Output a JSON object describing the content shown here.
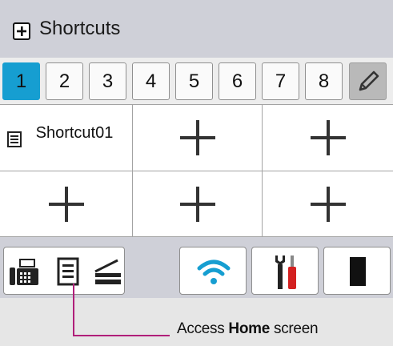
{
  "header": {
    "title": "Shortcuts",
    "icon": "add-box-icon"
  },
  "tabs": [
    {
      "label": "1",
      "active": true
    },
    {
      "label": "2",
      "active": false
    },
    {
      "label": "3",
      "active": false
    },
    {
      "label": "4",
      "active": false
    },
    {
      "label": "5",
      "active": false
    },
    {
      "label": "6",
      "active": false
    },
    {
      "label": "7",
      "active": false
    },
    {
      "label": "8",
      "active": false
    }
  ],
  "edit_tab_icon": "pencil-icon",
  "grid": {
    "cells": [
      {
        "type": "shortcut",
        "label": "Shortcut01",
        "icon": "copy-document-icon"
      },
      {
        "type": "empty",
        "icon": "plus-icon"
      },
      {
        "type": "empty",
        "icon": "plus-icon"
      },
      {
        "type": "empty",
        "icon": "plus-icon"
      },
      {
        "type": "empty",
        "icon": "plus-icon"
      },
      {
        "type": "empty",
        "icon": "plus-icon"
      }
    ]
  },
  "bottom_bar": {
    "home_button_icons": [
      "fax-icon",
      "copy-document-icon",
      "scanner-icon"
    ],
    "wifi_icon": "wifi-icon",
    "tools_icon": "settings-tools-icon",
    "toner_icon": "toner-icon"
  },
  "callout": {
    "prefix": "Access ",
    "bold": "Home",
    "suffix": " screen"
  },
  "colors": {
    "accent": "#169ed1",
    "callout_line": "#b01f7a",
    "header_bg": "#cfd0d8"
  }
}
